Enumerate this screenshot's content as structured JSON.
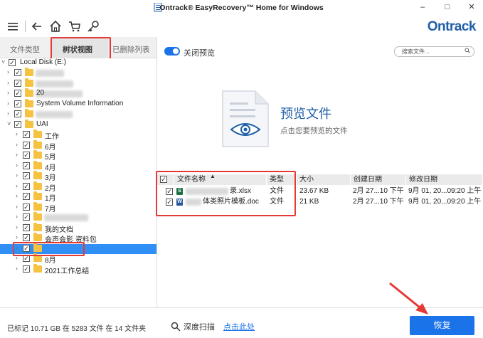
{
  "window": {
    "title": "Ontrack® EasyRecovery™ Home for Windows",
    "minimize": "–",
    "maximize": "□",
    "close": "✕"
  },
  "toolbar": {
    "logo": "Ontrack"
  },
  "tabs": [
    {
      "label": "文件类型"
    },
    {
      "label": "树状视图",
      "active": true
    },
    {
      "label": "已删除列表"
    }
  ],
  "tree": {
    "root_label": "Local Disk (E:)",
    "items": [
      {
        "label": "",
        "level": 1,
        "checked": true,
        "blurred": true
      },
      {
        "label": "",
        "level": 1,
        "checked": true,
        "blurred": true
      },
      {
        "label": "20",
        "level": 1,
        "checked": true,
        "blurred": true
      },
      {
        "label": "System Volume Information",
        "level": 1,
        "checked": true
      },
      {
        "label": "",
        "level": 1,
        "checked": true,
        "blurred": true
      },
      {
        "label": "UAI",
        "level": 1,
        "checked": true,
        "expanded": true
      },
      {
        "label": "工作",
        "level": 2,
        "checked": true
      },
      {
        "label": "6月",
        "level": 2,
        "checked": true
      },
      {
        "label": "5月",
        "level": 2,
        "checked": true
      },
      {
        "label": "4月",
        "level": 2,
        "checked": true
      },
      {
        "label": "3月",
        "level": 2,
        "checked": true
      },
      {
        "label": "2月",
        "level": 2,
        "checked": true
      },
      {
        "label": "1月",
        "level": 2,
        "checked": true
      },
      {
        "label": "7月",
        "level": 2,
        "checked": true
      },
      {
        "label": "",
        "level": 2,
        "checked": true,
        "blurred": true
      },
      {
        "label": "我的文档",
        "level": 2,
        "checked": true
      },
      {
        "label": "会声会影 资料包",
        "level": 2,
        "checked": true
      },
      {
        "label": "",
        "level": 2,
        "checked": true,
        "selected": true
      },
      {
        "label": "8月",
        "level": 2,
        "checked": true
      },
      {
        "label": "2021工作总结",
        "level": 2,
        "checked": true
      }
    ]
  },
  "preview": {
    "toggle_label": "关闭预览",
    "search_placeholder": "搜索文件...",
    "title": "预览文件",
    "subtitle": "点击您要预览的文件"
  },
  "table": {
    "columns": [
      "文件名称",
      "类型",
      "大小",
      "创建日期",
      "修改日期"
    ],
    "rows": [
      {
        "name": "录.xlsx",
        "type": "文件",
        "size": "23.67 KB",
        "created": "2月 27...10 下午",
        "modified": "9月 01, 20...09:20 上午",
        "icon": "S",
        "icon_color": "#1e7145"
      },
      {
        "name": "体类照片模板.doc",
        "type": "文件",
        "size": "21 KB",
        "created": "2月 27...10 下午",
        "modified": "9月 01, 20...09:20 上午",
        "icon": "W",
        "icon_color": "#2b579a"
      }
    ]
  },
  "status": {
    "summary": "已标记 10.71 GB 在 5283 文件 在 14 文件夹",
    "deep_scan": "深度扫描",
    "deep_link": "点击此处",
    "recover": "恢复"
  },
  "colors": {
    "accent": "#1a73e8",
    "highlight": "#e53935",
    "folder": "#f5c242"
  }
}
